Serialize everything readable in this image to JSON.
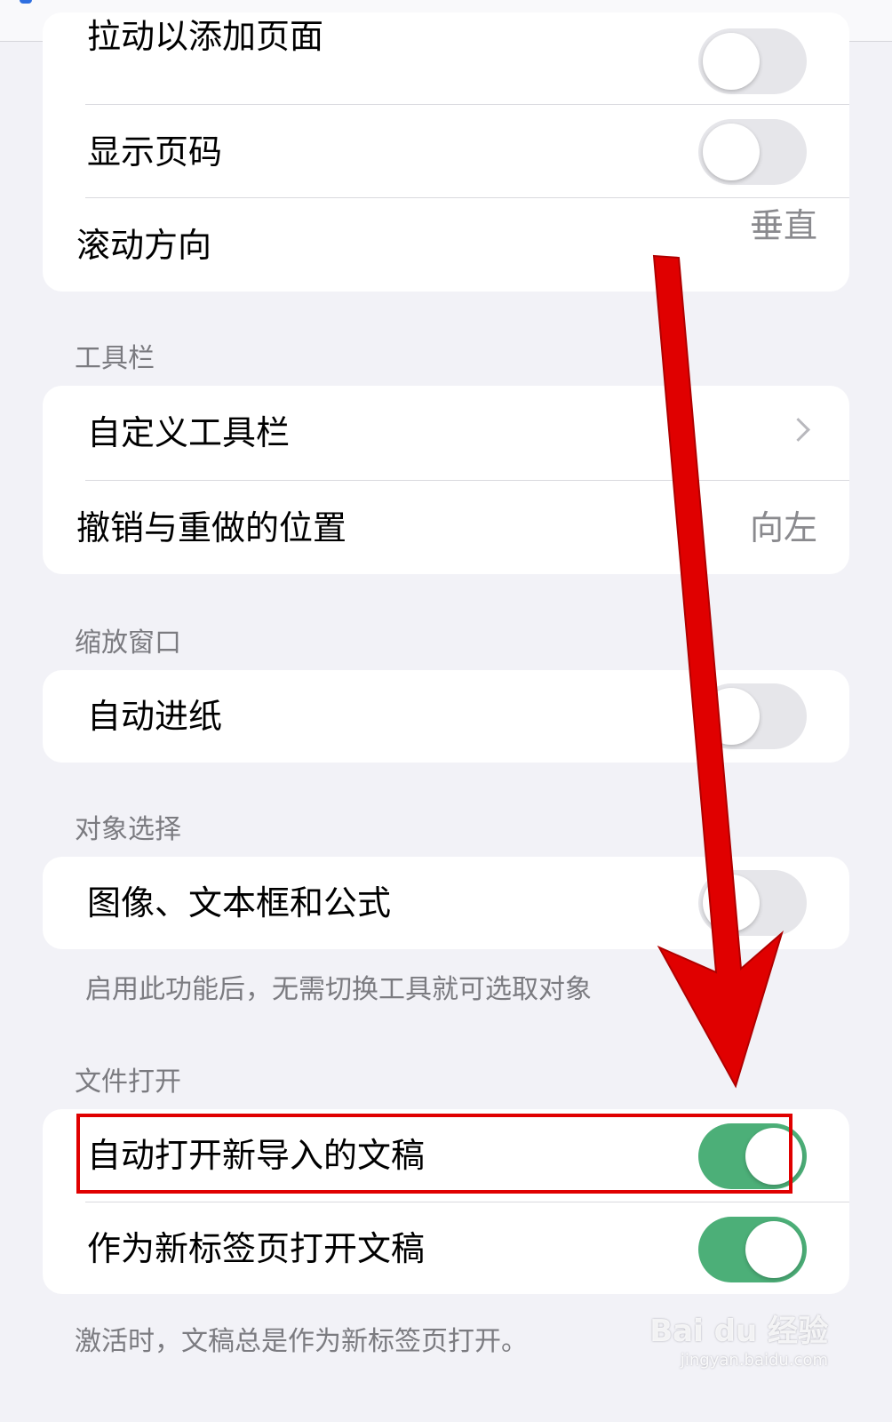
{
  "top_card": {
    "rows": [
      {
        "label": "拉动以添加页面",
        "toggle_on": false
      },
      {
        "label": "显示页码",
        "toggle_on": false
      },
      {
        "label": "滚动方向",
        "value": "垂直"
      }
    ]
  },
  "toolbar_section": {
    "title": "工具栏",
    "rows": [
      {
        "label": "自定义工具栏"
      },
      {
        "label": "撤销与重做的位置",
        "value": "向左"
      }
    ]
  },
  "zoom_section": {
    "title": "缩放窗口",
    "rows": [
      {
        "label": "自动进纸",
        "toggle_on": false
      }
    ]
  },
  "object_section": {
    "title": "对象选择",
    "rows": [
      {
        "label": "图像、文本框和公式",
        "toggle_on": false
      }
    ],
    "footnote": "启用此功能后，无需切换工具就可选取对象"
  },
  "file_section": {
    "title": "文件打开",
    "rows": [
      {
        "label": "自动打开新导入的文稿",
        "toggle_on": true
      },
      {
        "label": "作为新标签页打开文稿",
        "toggle_on": true
      }
    ],
    "footnote": "激活时，文稿总是作为新标签页打开。"
  },
  "watermark": {
    "brand": "Bai du 经验",
    "url": "jingyan.baidu.com"
  },
  "colors": {
    "toggle_on": "#4caf78",
    "annotation_red": "#e00000"
  }
}
